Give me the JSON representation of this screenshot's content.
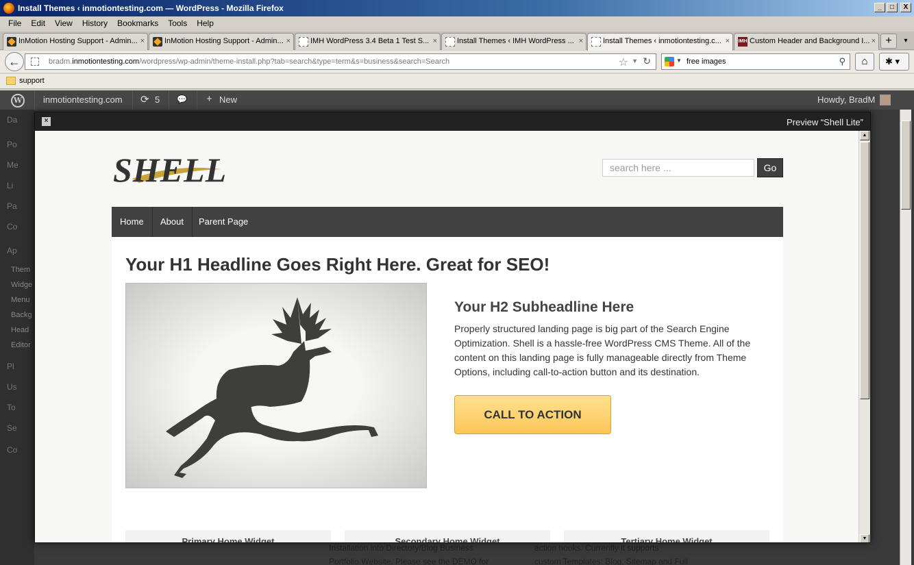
{
  "window": {
    "title": "Install Themes ‹ inmotiontesting.com — WordPress - Mozilla Firefox",
    "buttons": [
      "_",
      "□",
      "X"
    ]
  },
  "menu": [
    "File",
    "Edit",
    "View",
    "History",
    "Bookmarks",
    "Tools",
    "Help"
  ],
  "tabs": [
    {
      "label": "InMotion Hosting Support - Admin...",
      "icon": "imh-icon",
      "close": "×"
    },
    {
      "label": "InMotion Hosting Support - Admin...",
      "icon": "imh-icon",
      "close": "×"
    },
    {
      "label": "IMH WordPress 3.4 Beta 1 Test S...",
      "icon": "blank-page-icon",
      "close": "×"
    },
    {
      "label": "Install Themes ‹ IMH WordPress ...",
      "icon": "blank-page-icon",
      "close": "×"
    },
    {
      "label": "Install Themes ‹ inmotiontesting.c...",
      "icon": "blank-page-icon",
      "close": "×"
    },
    {
      "label": "Custom Header and Background I...",
      "icon": "imh-red-icon",
      "close": "×"
    }
  ],
  "new_tab": "+",
  "tab_list_arrow": "▾",
  "nav": {
    "url_host_prefix": "bradm.",
    "url_host": "inmotiontesting.com",
    "url_path": "/wordpress/wp-admin/theme-install.php?tab=search&type=term&s=business&search=Search",
    "search_value": "free images",
    "search_engine_favicon": "IMH",
    "back_glyph": "←",
    "star_glyph": "☆",
    "reload_glyph": "↻",
    "home_glyph": "⌂",
    "search_glyph": "⚲",
    "addon_glyph": "✱ ▾"
  },
  "bookmarks": [
    {
      "label": "support"
    }
  ],
  "adminbar": {
    "site": "inmotiontesting.com",
    "updates": "5",
    "update_glyph": "⟳",
    "comments_glyph": "💬",
    "new": "New",
    "new_glyph": "+",
    "howdy": "Howdy, BradM",
    "wp_logo": "W"
  },
  "wp_sidebar": {
    "menu": [
      "Da",
      "Po",
      "Me",
      "Li",
      "Pa",
      "Co",
      "Ap",
      "Pl",
      "Us",
      "To",
      "Se",
      "Co"
    ],
    "appearance_sub": [
      "Them",
      "Widge",
      "Menu",
      "Backg",
      "Head",
      "Editor"
    ]
  },
  "wp_background_text": {
    "col1": [
      "Installation into Directory/Blog Business",
      "Portfolio Website. Please see the DEMO for"
    ],
    "col2": [
      "action hooks. Currently it supports",
      "custom Templates: Blog, Sitemap and Full"
    ]
  },
  "modal": {
    "close": "×",
    "title": "Preview “Shell Lite”"
  },
  "theme": {
    "logo_text": "SHELL",
    "search_placeholder": "search here ...",
    "search_button": "Go",
    "nav": [
      "Home",
      "About",
      "Parent Page"
    ],
    "h1": "Your H1 Headline Goes Right Here. Great for SEO!",
    "h2": "Your H2 Subheadline Here",
    "paragraph": "Properly structured landing page is big part of the Search Engine Optimization. Shell is a hassle-free WordPress CMS Theme. All of the content on this landing page is fully manageable directly from Theme Options, including call-to-action button and its destination.",
    "cta": "CALL TO ACTION",
    "widgets": [
      "Primary Home Widget",
      "Secondary Home Widget",
      "Tertiary Home Widget"
    ],
    "hero_image": "deer-silhouette",
    "colors": {
      "nav_bg": "#414141",
      "cta_bg": "#fcc557",
      "cta_border": "#e3a12b",
      "logo_swoosh": "#c9a43b"
    }
  }
}
